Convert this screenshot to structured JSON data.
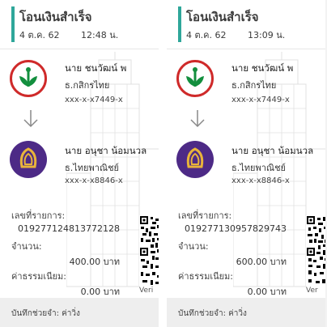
{
  "slips": [
    {
      "title": "โอนเงินสำเร็จ",
      "date": "4 ต.ค. 62",
      "time": "12:48 น.",
      "sender": {
        "name": "นาย ชนวัฒน์ พ",
        "bank": "ธ.กสิกรไทย",
        "account": "xxx-x-x7449-x"
      },
      "receiver": {
        "name": "นาย อนุชา น้อมนวล",
        "bank": "ธ.ไทยพาณิชย์",
        "account": "xxx-x-x8846-x"
      },
      "ref_label": "เลขที่รายการ:",
      "ref_value": "019277124813772128",
      "amount_label": "จำนวน:",
      "amount_value": "400.00 บาท",
      "fee_label": "ค่าธรรมเนียม:",
      "fee_value": "0.00 บาท",
      "verify_text": "Veri",
      "memo": "บันทึกช่วยจำ: ค่าวิ่ง"
    },
    {
      "title": "โอนเงินสำเร็จ",
      "date": "4 ต.ค. 62",
      "time": "13:09 น.",
      "sender": {
        "name": "นาย ชนวัฒน์ พ",
        "bank": "ธ.กสิกรไทย",
        "account": "xxx-x-x7449-x"
      },
      "receiver": {
        "name": "นาย อนุชา น้อมนวล",
        "bank": "ธ.ไทยพาณิชย์",
        "account": "xxx-x-x8846-x"
      },
      "ref_label": "เลขที่รายการ:",
      "ref_value": "019277130957829743",
      "amount_label": "จำนวน:",
      "amount_value": "600.00 บาท",
      "fee_label": "ค่าธรรมเนียม:",
      "fee_value": "0.00 บาท",
      "verify_text": "Ver",
      "memo": "บันทึกช่วยจำ: ค่าวิ่ง"
    }
  ],
  "colors": {
    "accent": "#2fa79a",
    "kbank_red": "#cf2a2a",
    "kbank_green": "#138f3e",
    "scb_purple": "#4d2a86",
    "scb_gold": "#e9b43a"
  },
  "icons": {
    "sender_logo": "kasikorn-bank-logo",
    "receiver_logo": "scb-logo",
    "arrow": "arrow-down-icon",
    "qr": "qr-code-icon"
  }
}
